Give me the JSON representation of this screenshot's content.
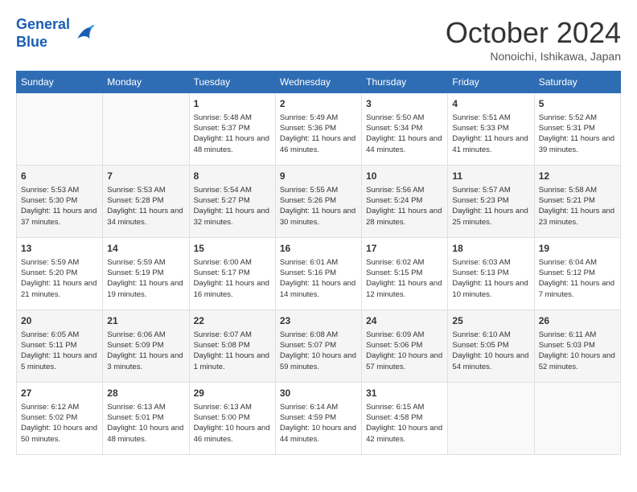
{
  "header": {
    "logo_line1": "General",
    "logo_line2": "Blue",
    "month": "October 2024",
    "location": "Nonoichi, Ishikawa, Japan"
  },
  "weekdays": [
    "Sunday",
    "Monday",
    "Tuesday",
    "Wednesday",
    "Thursday",
    "Friday",
    "Saturday"
  ],
  "weeks": [
    [
      {
        "day": "",
        "info": ""
      },
      {
        "day": "",
        "info": ""
      },
      {
        "day": "1",
        "info": "Sunrise: 5:48 AM\nSunset: 5:37 PM\nDaylight: 11 hours and 48 minutes."
      },
      {
        "day": "2",
        "info": "Sunrise: 5:49 AM\nSunset: 5:36 PM\nDaylight: 11 hours and 46 minutes."
      },
      {
        "day": "3",
        "info": "Sunrise: 5:50 AM\nSunset: 5:34 PM\nDaylight: 11 hours and 44 minutes."
      },
      {
        "day": "4",
        "info": "Sunrise: 5:51 AM\nSunset: 5:33 PM\nDaylight: 11 hours and 41 minutes."
      },
      {
        "day": "5",
        "info": "Sunrise: 5:52 AM\nSunset: 5:31 PM\nDaylight: 11 hours and 39 minutes."
      }
    ],
    [
      {
        "day": "6",
        "info": "Sunrise: 5:53 AM\nSunset: 5:30 PM\nDaylight: 11 hours and 37 minutes."
      },
      {
        "day": "7",
        "info": "Sunrise: 5:53 AM\nSunset: 5:28 PM\nDaylight: 11 hours and 34 minutes."
      },
      {
        "day": "8",
        "info": "Sunrise: 5:54 AM\nSunset: 5:27 PM\nDaylight: 11 hours and 32 minutes."
      },
      {
        "day": "9",
        "info": "Sunrise: 5:55 AM\nSunset: 5:26 PM\nDaylight: 11 hours and 30 minutes."
      },
      {
        "day": "10",
        "info": "Sunrise: 5:56 AM\nSunset: 5:24 PM\nDaylight: 11 hours and 28 minutes."
      },
      {
        "day": "11",
        "info": "Sunrise: 5:57 AM\nSunset: 5:23 PM\nDaylight: 11 hours and 25 minutes."
      },
      {
        "day": "12",
        "info": "Sunrise: 5:58 AM\nSunset: 5:21 PM\nDaylight: 11 hours and 23 minutes."
      }
    ],
    [
      {
        "day": "13",
        "info": "Sunrise: 5:59 AM\nSunset: 5:20 PM\nDaylight: 11 hours and 21 minutes."
      },
      {
        "day": "14",
        "info": "Sunrise: 5:59 AM\nSunset: 5:19 PM\nDaylight: 11 hours and 19 minutes."
      },
      {
        "day": "15",
        "info": "Sunrise: 6:00 AM\nSunset: 5:17 PM\nDaylight: 11 hours and 16 minutes."
      },
      {
        "day": "16",
        "info": "Sunrise: 6:01 AM\nSunset: 5:16 PM\nDaylight: 11 hours and 14 minutes."
      },
      {
        "day": "17",
        "info": "Sunrise: 6:02 AM\nSunset: 5:15 PM\nDaylight: 11 hours and 12 minutes."
      },
      {
        "day": "18",
        "info": "Sunrise: 6:03 AM\nSunset: 5:13 PM\nDaylight: 11 hours and 10 minutes."
      },
      {
        "day": "19",
        "info": "Sunrise: 6:04 AM\nSunset: 5:12 PM\nDaylight: 11 hours and 7 minutes."
      }
    ],
    [
      {
        "day": "20",
        "info": "Sunrise: 6:05 AM\nSunset: 5:11 PM\nDaylight: 11 hours and 5 minutes."
      },
      {
        "day": "21",
        "info": "Sunrise: 6:06 AM\nSunset: 5:09 PM\nDaylight: 11 hours and 3 minutes."
      },
      {
        "day": "22",
        "info": "Sunrise: 6:07 AM\nSunset: 5:08 PM\nDaylight: 11 hours and 1 minute."
      },
      {
        "day": "23",
        "info": "Sunrise: 6:08 AM\nSunset: 5:07 PM\nDaylight: 10 hours and 59 minutes."
      },
      {
        "day": "24",
        "info": "Sunrise: 6:09 AM\nSunset: 5:06 PM\nDaylight: 10 hours and 57 minutes."
      },
      {
        "day": "25",
        "info": "Sunrise: 6:10 AM\nSunset: 5:05 PM\nDaylight: 10 hours and 54 minutes."
      },
      {
        "day": "26",
        "info": "Sunrise: 6:11 AM\nSunset: 5:03 PM\nDaylight: 10 hours and 52 minutes."
      }
    ],
    [
      {
        "day": "27",
        "info": "Sunrise: 6:12 AM\nSunset: 5:02 PM\nDaylight: 10 hours and 50 minutes."
      },
      {
        "day": "28",
        "info": "Sunrise: 6:13 AM\nSunset: 5:01 PM\nDaylight: 10 hours and 48 minutes."
      },
      {
        "day": "29",
        "info": "Sunrise: 6:13 AM\nSunset: 5:00 PM\nDaylight: 10 hours and 46 minutes."
      },
      {
        "day": "30",
        "info": "Sunrise: 6:14 AM\nSunset: 4:59 PM\nDaylight: 10 hours and 44 minutes."
      },
      {
        "day": "31",
        "info": "Sunrise: 6:15 AM\nSunset: 4:58 PM\nDaylight: 10 hours and 42 minutes."
      },
      {
        "day": "",
        "info": ""
      },
      {
        "day": "",
        "info": ""
      }
    ]
  ]
}
